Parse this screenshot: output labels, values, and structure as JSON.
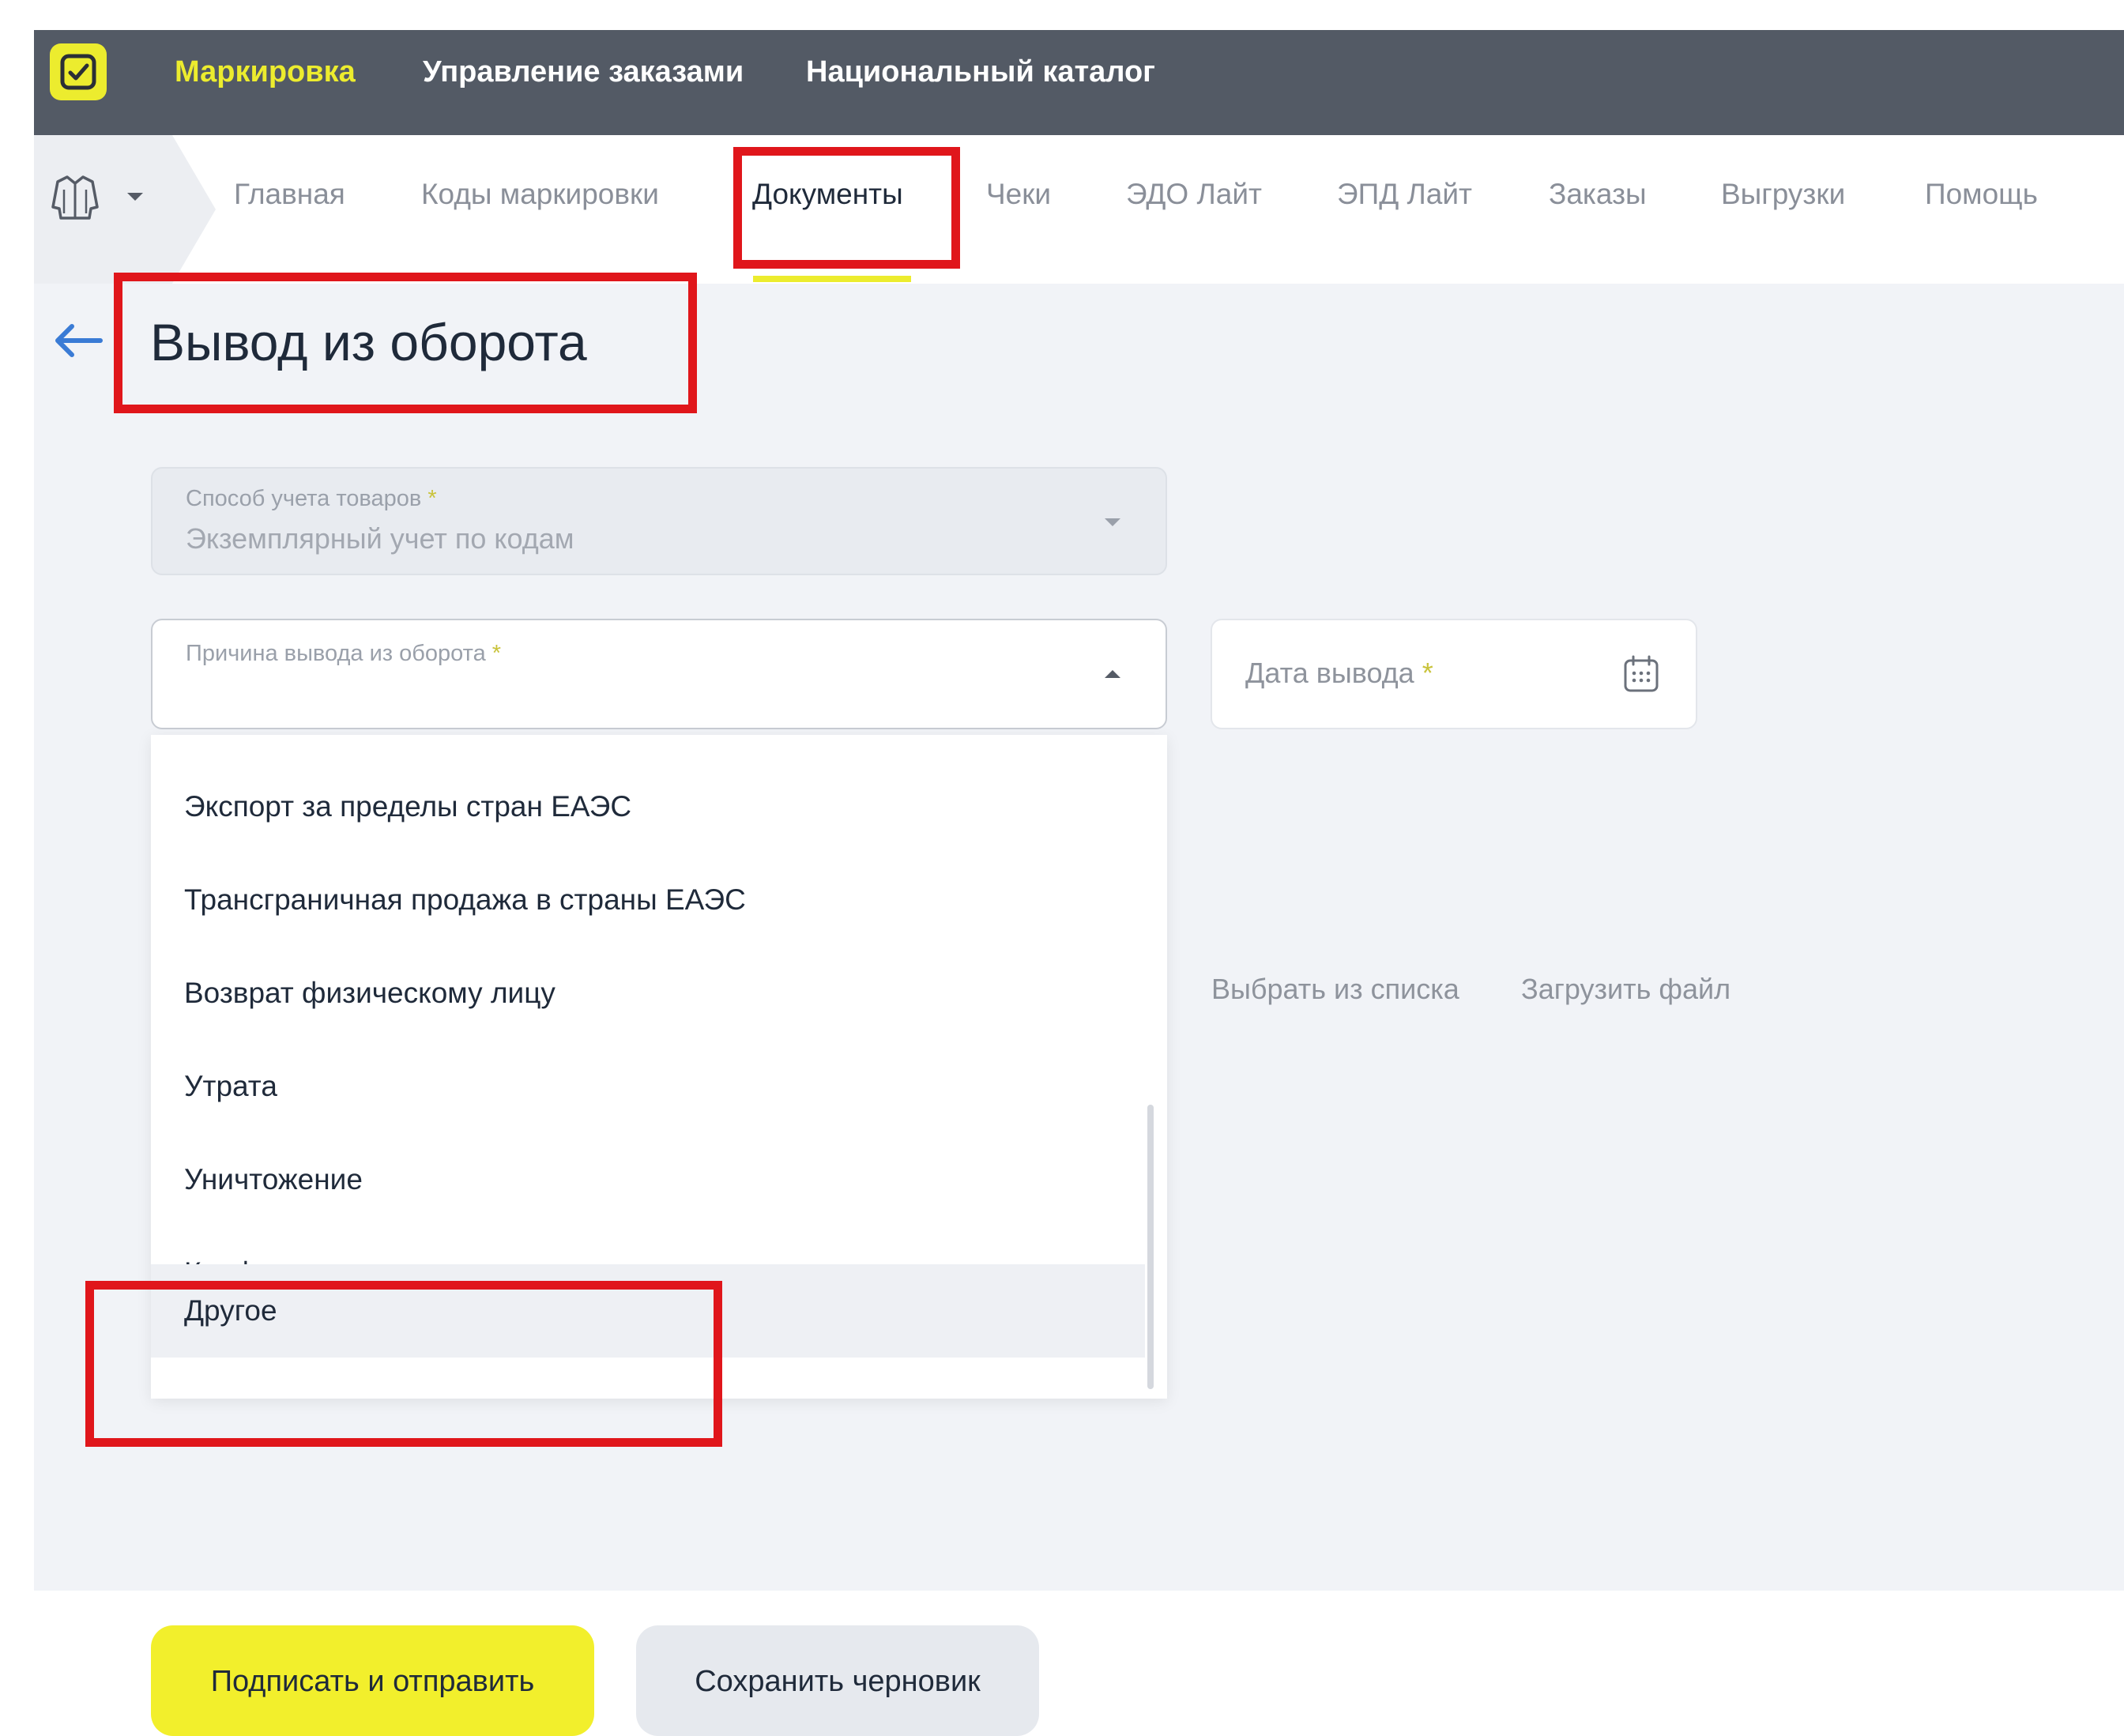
{
  "topnav": {
    "items": [
      {
        "label": "Маркировка",
        "active": true
      },
      {
        "label": "Управление заказами",
        "active": false
      },
      {
        "label": "Национальный каталог",
        "active": false
      }
    ]
  },
  "subnav": {
    "product_icon": "jacket-icon",
    "items": [
      {
        "label": "Главная"
      },
      {
        "label": "Коды маркировки"
      },
      {
        "label": "Документы",
        "active": true
      },
      {
        "label": "Чеки"
      },
      {
        "label": "ЭДО Лайт"
      },
      {
        "label": "ЭПД Лайт"
      },
      {
        "label": "Заказы"
      },
      {
        "label": "Выгрузки"
      },
      {
        "label": "Помощь"
      }
    ]
  },
  "page": {
    "title": "Вывод из оборота"
  },
  "form": {
    "accounting_method": {
      "label": "Способ учета товаров",
      "value": "Экземплярный учет по кодам"
    },
    "reason": {
      "label": "Причина вывода из оборота"
    },
    "date": {
      "placeholder": "Дата вывода"
    },
    "required_mark": "*"
  },
  "dropdown": {
    "options": [
      "Экспорт за пределы стран ЕАЭС",
      "Трансграничная продажа в страны ЕАЭС",
      "Возврат физическому лицу",
      "Утрата",
      "Уничтожение",
      "Конфискация",
      "Другое"
    ],
    "hovered": "Другое"
  },
  "codes_links": {
    "select_from_list": "Выбрать из списка",
    "upload_file": "Загрузить файл"
  },
  "actions": {
    "sign_and_send": "Подписать и отправить",
    "save_draft": "Сохранить черновик"
  },
  "colors": {
    "accent_yellow": "#ecec2e",
    "topbar": "#535a65",
    "highlight_red": "#e0161b",
    "back_arrow_blue": "#3a7bd5"
  }
}
